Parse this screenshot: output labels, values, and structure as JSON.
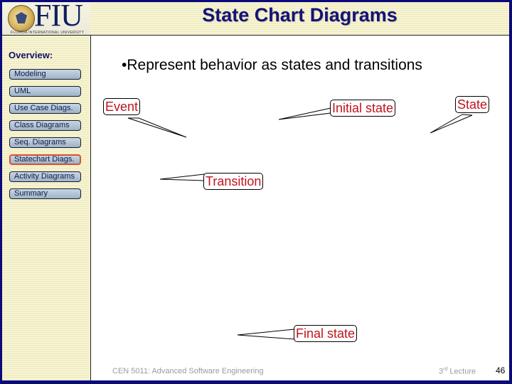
{
  "header": {
    "logo_text": "FIU",
    "logo_subtitle": "FLORIDA INTERNATIONAL UNIVERSITY",
    "title": "State Chart Diagrams"
  },
  "sidebar": {
    "heading": "Overview:",
    "items": [
      {
        "label": "Modeling",
        "active": false
      },
      {
        "label": "UML",
        "active": false
      },
      {
        "label": "Use Case Diags.",
        "active": false
      },
      {
        "label": "Class Diagrams",
        "active": false
      },
      {
        "label": "Seq. Diagrams",
        "active": false
      },
      {
        "label": "Statechart Diags.",
        "active": true
      },
      {
        "label": "Activity Diagrams",
        "active": false
      },
      {
        "label": "Summary",
        "active": false
      }
    ]
  },
  "content": {
    "bullet": "•Represent behavior as states and transitions",
    "callouts": {
      "event": "Event",
      "initial_state": "Initial state",
      "state": "State",
      "transition": "Transition",
      "final_state": "Final state"
    }
  },
  "footer": {
    "course": "CEN 5011: Advanced Software Engineering",
    "lecture_num": "3",
    "lecture_sup": "rd",
    "lecture_label": " Lecture",
    "page": "46"
  },
  "colors": {
    "frame": "#0a0a7a",
    "title": "#13137a",
    "callout_text": "#c0141e",
    "active_nav_border": "#d9502a"
  }
}
